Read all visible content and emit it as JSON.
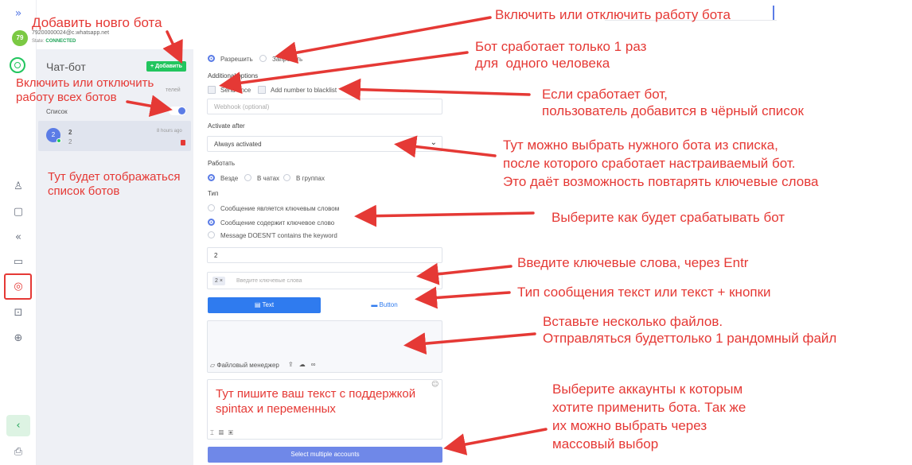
{
  "header": {
    "avatar_number": "79",
    "account_id": "79200000024@c.whatsapp.net",
    "state_label": "State:",
    "state_value": "CONNECTED",
    "expand_glyph": "»"
  },
  "sidebar": {
    "title": "Чат-бот",
    "add_button": "+ Добавить",
    "hidden_text": "телей",
    "list_toggle_label": "Список",
    "bot": {
      "badge": "2",
      "name": "2",
      "subtitle": "2",
      "time": "8 hours ago"
    }
  },
  "form": {
    "allow_label": "Разрешить",
    "deny_label": "Запретить",
    "additional_options_title": "Additional options",
    "send_once_label": "Send once",
    "blacklist_label": "Add number to blacklist",
    "webhook_placeholder": "Webhook (optional)",
    "activate_after_title": "Activate after",
    "activate_after_value": "Always activated",
    "work_title": "Работать",
    "work_everywhere": "Везде",
    "work_chats": "В чатах",
    "work_groups": "В группах",
    "type_title": "Тип",
    "type_is_keyword": "Сообщение является ключевым словом",
    "type_contains_keyword": "Сообщение содержит ключевое слово",
    "type_not_contains": "Message DOESN'T contains the keyword",
    "input_value": "2",
    "keyword_tag": "2",
    "keyword_placeholder": "Введите ключевые слова",
    "tab_text": "Text",
    "tab_button": "Button",
    "file_manager": "Файловый менеджер",
    "select_accounts_button": "Select multiple accounts"
  },
  "annotations": {
    "add_bot": "Добавить новго бота",
    "toggle_bot": "Включить или отключить работу бота",
    "toggle_all": "Включить или отключить\nработу всех ботов",
    "once_per_person": "Бот сработает только 1 раз\nдля  одного человека",
    "blacklist": "Если сработает бот,\nпользователь добавится в чёрный список",
    "bot_list": "Тут будет отображаться\nсписок ботов",
    "choose_bot": "Тут можно выбрать нужного бота из списка,\nпосле которого сработает настраиваемый бот.\nЭто даёт возможность повтарять ключевые слова",
    "trigger_type": "Выберите как будет срабатывать бот",
    "keywords": "Введите ключевые слова, через Entr",
    "message_type": "Тип сообщения текст или текст + кнопки",
    "files": "Вставьте несколько файлов.\nОтправляться будеттолько 1 рандомный файл",
    "text_area": "Тут пишите ваш текст с поддержкой\nspintax и переменных",
    "accounts": "Выберите аккаунты к которым\nхотите применить бота. Так же\nих можно выбрать через\nмассовый выбор"
  },
  "colors": {
    "accent_blue": "#2f7bef",
    "brand_green": "#22c55e",
    "annotation_red": "#e53935",
    "select_button": "#6f88e8"
  },
  "icons": [
    "expand-icon",
    "whatsapp-icon",
    "user-icon",
    "chat-icon",
    "reply-all-icon",
    "messages-icon",
    "bot-icon",
    "robot-icon",
    "globe-icon",
    "chevron-left-icon",
    "printer-icon",
    "trash-icon",
    "chevron-down-icon",
    "file-icon",
    "upload-icon",
    "cloud-icon",
    "link-icon",
    "smile-icon"
  ]
}
